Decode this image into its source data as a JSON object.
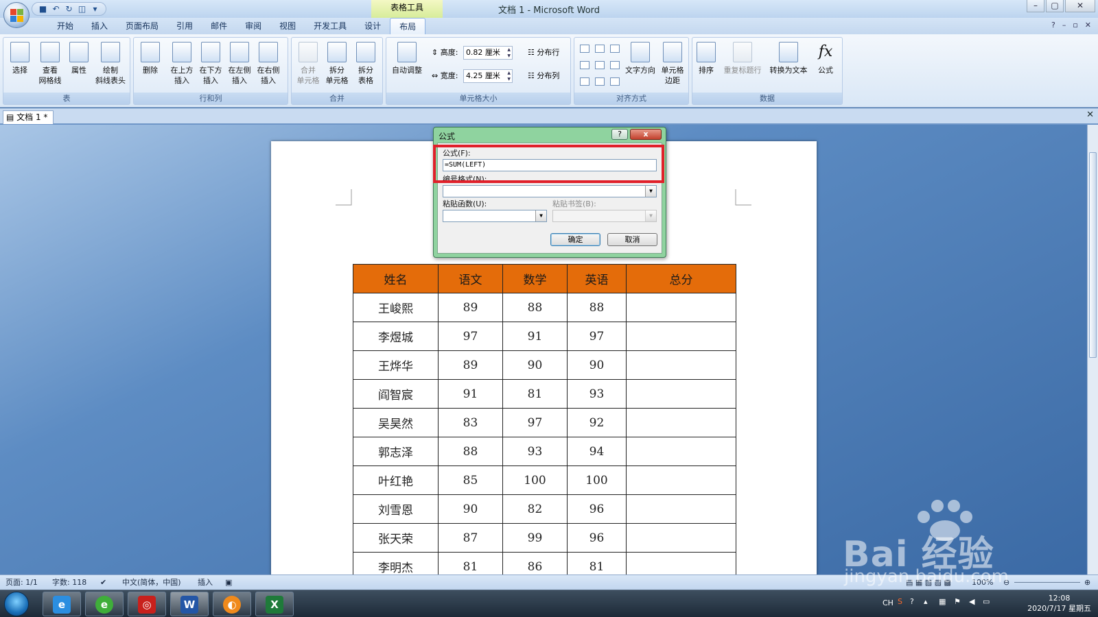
{
  "title_bar": {
    "title": "文档 1 - Microsoft Word",
    "contextual_tab_group": "表格工具"
  },
  "ribbon_tabs": [
    "开始",
    "插入",
    "页面布局",
    "引用",
    "邮件",
    "审阅",
    "视图",
    "开发工具",
    "设计",
    "布局"
  ],
  "active_tab": "布局",
  "ribbon": {
    "table_group": {
      "label": "表",
      "buttons": [
        "选择",
        "查看\n网格线",
        "属性",
        "绘制\n斜线表头"
      ]
    },
    "rows_cols_group": {
      "label": "行和列",
      "buttons": [
        "删除",
        "在上方\n插入",
        "在下方\n插入",
        "在左侧\n插入",
        "在右侧\n插入"
      ]
    },
    "merge_group": {
      "label": "合并",
      "buttons": [
        "合并\n单元格",
        "拆分\n单元格",
        "拆分\n表格"
      ]
    },
    "cell_size_group": {
      "label": "单元格大小",
      "autofit": "自动调整",
      "height_label": "高度:",
      "height_value": "0.82 厘米",
      "width_label": "宽度:",
      "width_value": "4.25 厘米",
      "distribute_rows": "分布行",
      "distribute_cols": "分布列"
    },
    "alignment_group": {
      "label": "对齐方式",
      "text_direction": "文字方向",
      "cell_margins": "单元格\n边距"
    },
    "data_group": {
      "label": "数据",
      "buttons": [
        "排序",
        "重复标题行",
        "转换为文本",
        "公式"
      ]
    }
  },
  "document_tab": "文档 1 *",
  "dialog": {
    "title": "公式",
    "help_label": "?",
    "close_label": "x",
    "formula_label": "公式(F):",
    "formula_value": "=SUM(LEFT)",
    "number_format_label": "编号格式(N):",
    "number_format_value": "",
    "paste_function_label": "粘贴函数(U):",
    "paste_function_value": "",
    "paste_bookmark_label": "粘贴书签(B):",
    "paste_bookmark_value": "",
    "ok_label": "确定",
    "cancel_label": "取消"
  },
  "table": {
    "header_color": "#e46c0a",
    "headers": [
      "姓名",
      "语文",
      "数学",
      "英语",
      "总分"
    ],
    "rows": [
      [
        "王峻熙",
        "89",
        "88",
        "88",
        ""
      ],
      [
        "李煜城",
        "97",
        "91",
        "97",
        ""
      ],
      [
        "王烨华",
        "89",
        "90",
        "90",
        ""
      ],
      [
        "阎智宸",
        "91",
        "81",
        "93",
        ""
      ],
      [
        "吴昊然",
        "83",
        "97",
        "92",
        ""
      ],
      [
        "郭志泽",
        "88",
        "93",
        "94",
        ""
      ],
      [
        "叶红艳",
        "85",
        "100",
        "100",
        ""
      ],
      [
        "刘雪恩",
        "90",
        "82",
        "96",
        ""
      ],
      [
        "张天荣",
        "87",
        "99",
        "96",
        ""
      ],
      [
        "李明杰",
        "81",
        "86",
        "81",
        ""
      ]
    ]
  },
  "status_bar": {
    "page": "页面: 1/1",
    "word_count": "字数: 118",
    "language": "中文(简体，中国)",
    "mode": "插入",
    "zoom": "100%"
  },
  "taskbar": {
    "ime": "CH",
    "time": "12:08",
    "date": "2020/7/17 星期五"
  },
  "watermark": {
    "brand": "Bai 经验",
    "url": "jingyan.baidu.com"
  },
  "colors": {
    "highlight": "#e0202a",
    "dialog_frame": "#8fd39f"
  }
}
